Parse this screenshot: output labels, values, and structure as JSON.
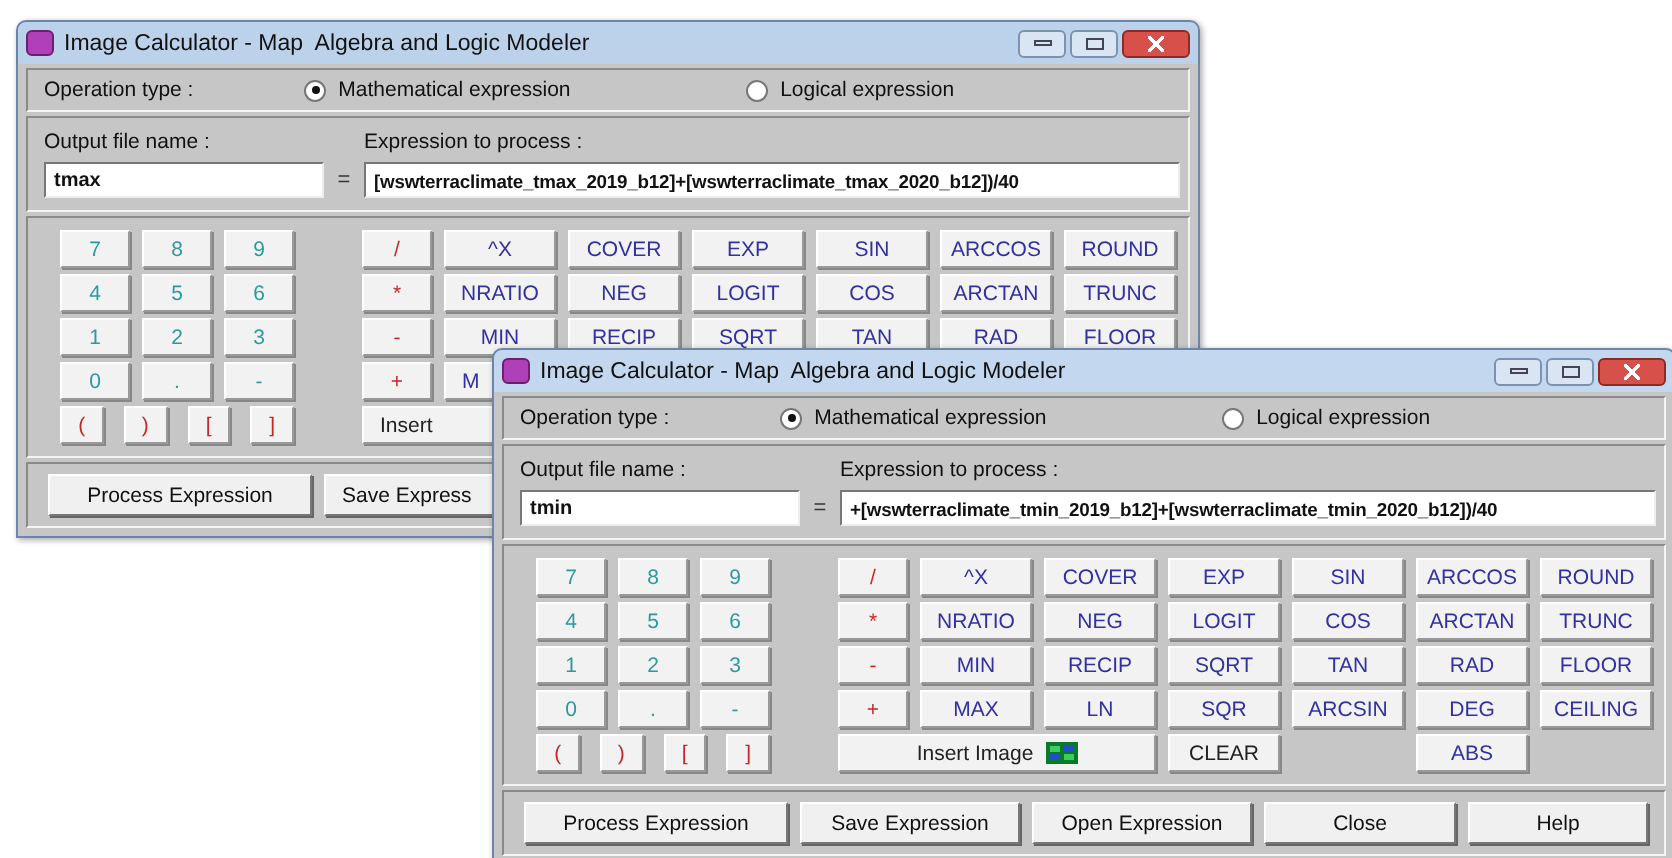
{
  "windows": [
    {
      "title": "Image Calculator - Map  Algebra and Logic Modeler",
      "operation": {
        "label": "Operation type :",
        "options": [
          {
            "label": "Mathematical expression",
            "selected": true
          },
          {
            "label": "Logical expression",
            "selected": false
          }
        ]
      },
      "output": {
        "label": "Output file name :",
        "value": "tmax"
      },
      "equals": "=",
      "expression": {
        "label": "Expression to process :",
        "value": "[wswterraclimate_tmax_2019_b12]+[wswterraclimate_tmax_2020_b12])/40"
      },
      "keypad": {
        "digit_rows": [
          [
            "7",
            "8",
            "9"
          ],
          [
            "4",
            "5",
            "6"
          ],
          [
            "1",
            "2",
            "3"
          ],
          [
            "0",
            ".",
            "-"
          ]
        ],
        "bracket_row": [
          "(",
          ")",
          "[",
          "]"
        ],
        "operators": [
          "/",
          "*",
          "-",
          "+"
        ],
        "function_rows": [
          [
            {
              "label": "^X",
              "kind": "function",
              "truncated": false
            },
            {
              "label": "COVER",
              "kind": "function",
              "truncated": false
            },
            {
              "label": "EXP",
              "kind": "function",
              "truncated": false
            },
            {
              "label": "SIN",
              "kind": "function",
              "truncated": false
            },
            {
              "label": "ARCCOS",
              "kind": "function",
              "truncated": false
            },
            {
              "label": "ROUND",
              "kind": "function",
              "truncated": false
            }
          ],
          [
            {
              "label": "NRATIO",
              "kind": "function",
              "truncated": false
            },
            {
              "label": "NEG",
              "kind": "function",
              "truncated": false
            },
            {
              "label": "LOGIT",
              "kind": "function",
              "truncated": false
            },
            {
              "label": "COS",
              "kind": "function",
              "truncated": false
            },
            {
              "label": "ARCTAN",
              "kind": "function",
              "truncated": false
            },
            {
              "label": "TRUNC",
              "kind": "function",
              "truncated": false
            }
          ],
          [
            {
              "label": "MIN",
              "kind": "function",
              "truncated": false
            },
            {
              "label": "RECIP",
              "kind": "function",
              "truncated": false
            },
            {
              "label": "SQRT",
              "kind": "function",
              "truncated": false
            },
            {
              "label": "TAN",
              "kind": "function",
              "truncated": false
            },
            {
              "label": "RAD",
              "kind": "function",
              "truncated": false
            },
            {
              "label": "FLOOR",
              "kind": "function",
              "truncated": false
            }
          ],
          [
            {
              "label": "M",
              "kind": "function",
              "truncated": true
            }
          ],
          [
            {
              "label": "Insert",
              "kind": "insert",
              "truncated": true
            }
          ]
        ]
      },
      "bottom_buttons": [
        {
          "label": "Process Expression",
          "truncated": false
        },
        {
          "label": "Save Express",
          "truncated": true
        }
      ]
    },
    {
      "title": "Image Calculator - Map  Algebra and Logic Modeler",
      "operation": {
        "label": "Operation type :",
        "options": [
          {
            "label": "Mathematical expression",
            "selected": true
          },
          {
            "label": "Logical expression",
            "selected": false
          }
        ]
      },
      "output": {
        "label": "Output file name :",
        "value": "tmin"
      },
      "equals": "=",
      "expression": {
        "label": "Expression to process :",
        "value": "+[wswterraclimate_tmin_2019_b12]+[wswterraclimate_tmin_2020_b12])/40"
      },
      "keypad": {
        "digit_rows": [
          [
            "7",
            "8",
            "9"
          ],
          [
            "4",
            "5",
            "6"
          ],
          [
            "1",
            "2",
            "3"
          ],
          [
            "0",
            ".",
            "-"
          ]
        ],
        "bracket_row": [
          "(",
          ")",
          "[",
          "]"
        ],
        "operators": [
          "/",
          "*",
          "-",
          "+"
        ],
        "function_rows": [
          [
            {
              "label": "^X",
              "kind": "function",
              "truncated": false
            },
            {
              "label": "COVER",
              "kind": "function",
              "truncated": false
            },
            {
              "label": "EXP",
              "kind": "function",
              "truncated": false
            },
            {
              "label": "SIN",
              "kind": "function",
              "truncated": false
            },
            {
              "label": "ARCCOS",
              "kind": "function",
              "truncated": false
            },
            {
              "label": "ROUND",
              "kind": "function",
              "truncated": false
            }
          ],
          [
            {
              "label": "NRATIO",
              "kind": "function",
              "truncated": false
            },
            {
              "label": "NEG",
              "kind": "function",
              "truncated": false
            },
            {
              "label": "LOGIT",
              "kind": "function",
              "truncated": false
            },
            {
              "label": "COS",
              "kind": "function",
              "truncated": false
            },
            {
              "label": "ARCTAN",
              "kind": "function",
              "truncated": false
            },
            {
              "label": "TRUNC",
              "kind": "function",
              "truncated": false
            }
          ],
          [
            {
              "label": "MIN",
              "kind": "function",
              "truncated": false
            },
            {
              "label": "RECIP",
              "kind": "function",
              "truncated": false
            },
            {
              "label": "SQRT",
              "kind": "function",
              "truncated": false
            },
            {
              "label": "TAN",
              "kind": "function",
              "truncated": false
            },
            {
              "label": "RAD",
              "kind": "function",
              "truncated": false
            },
            {
              "label": "FLOOR",
              "kind": "function",
              "truncated": false
            }
          ],
          [
            {
              "label": "MAX",
              "kind": "function",
              "truncated": false
            },
            {
              "label": "LN",
              "kind": "function",
              "truncated": false
            },
            {
              "label": "SQR",
              "kind": "function",
              "truncated": false
            },
            {
              "label": "ARCSIN",
              "kind": "function",
              "truncated": false
            },
            {
              "label": "DEG",
              "kind": "function",
              "truncated": false
            },
            {
              "label": "CEILING",
              "kind": "function",
              "truncated": false
            }
          ],
          [
            {
              "label": "Insert Image",
              "kind": "insert",
              "truncated": false
            },
            {
              "label": "CLEAR",
              "kind": "clear",
              "truncated": false
            },
            {
              "label": "ABS",
              "kind": "function",
              "truncated": false
            }
          ]
        ]
      },
      "bottom_buttons": [
        {
          "label": "Process Expression",
          "truncated": false
        },
        {
          "label": "Save Expression",
          "truncated": false
        },
        {
          "label": "Open Expression",
          "truncated": false
        },
        {
          "label": "Close",
          "truncated": false
        },
        {
          "label": "Help",
          "truncated": false
        }
      ]
    }
  ]
}
